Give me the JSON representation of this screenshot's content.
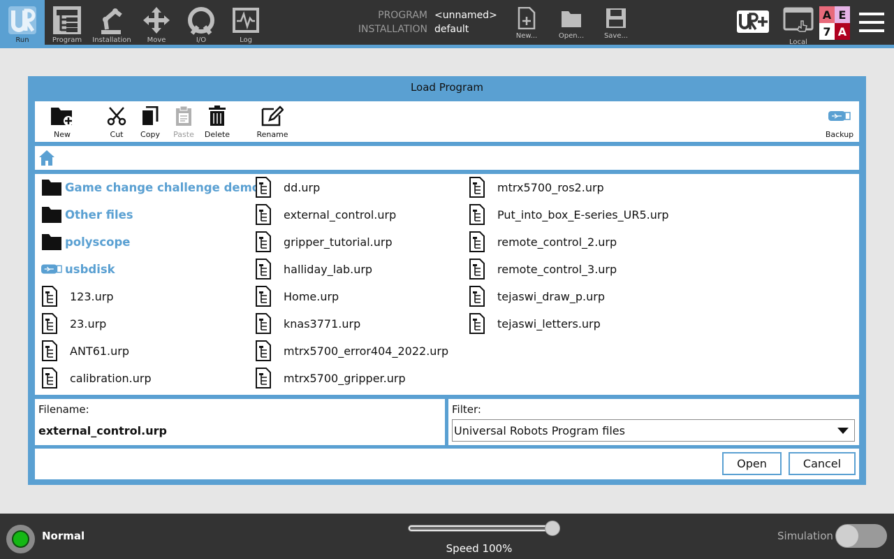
{
  "colors": {
    "accent": "#5aa0d2",
    "bar": "#333333",
    "status_ok": "#14b814"
  },
  "nav": {
    "items": [
      {
        "label": "Run",
        "icon": "ur-logo-icon"
      },
      {
        "label": "Program",
        "icon": "program-icon"
      },
      {
        "label": "Installation",
        "icon": "robot-arm-icon"
      },
      {
        "label": "Move",
        "icon": "move-arrows-icon"
      },
      {
        "label": "I/O",
        "icon": "io-icon"
      },
      {
        "label": "Log",
        "icon": "log-icon"
      }
    ]
  },
  "program_info": {
    "program_key": "PROGRAM",
    "program_value": "<unnamed>",
    "installation_key": "INSTALLATION",
    "installation_value": "default"
  },
  "file_actions": {
    "new": "New...",
    "open": "Open...",
    "save": "Save..."
  },
  "right": {
    "local": "Local",
    "ae7a": [
      "A",
      "E",
      "7",
      "A"
    ]
  },
  "dialog": {
    "title": "Load Program",
    "toolbar": {
      "new": "New",
      "cut": "Cut",
      "copy": "Copy",
      "paste": "Paste",
      "delete": "Delete",
      "rename": "Rename",
      "backup": "Backup"
    },
    "folders": [
      "Game change challenge demo",
      "Other files",
      "polyscope",
      "usbdisk"
    ],
    "files_col1": [
      "123.urp",
      "23.urp",
      "ANT61.urp",
      "calibration.urp"
    ],
    "files_col2": [
      "dd.urp",
      "external_control.urp",
      "gripper_tutorial.urp",
      "halliday_lab.urp",
      "Home.urp",
      "knas3771.urp",
      "mtrx5700_error404_2022.urp",
      "mtrx5700_gripper.urp"
    ],
    "files_col3": [
      "mtrx5700_ros2.urp",
      "Put_into_box_E-series_UR5.urp",
      "remote_control_2.urp",
      "remote_control_3.urp",
      "tejaswi_draw_p.urp",
      "tejaswi_letters.urp"
    ],
    "filename_label": "Filename:",
    "filename_value": "external_control.urp",
    "filter_label": "Filter:",
    "filter_value": "Universal Robots Program files",
    "open_label": "Open",
    "cancel_label": "Cancel"
  },
  "bottom": {
    "status": "Normal",
    "speed_label": "Speed 100%",
    "speed_fraction": 1.0,
    "simulation_label": "Simulation",
    "simulation_on": false
  }
}
